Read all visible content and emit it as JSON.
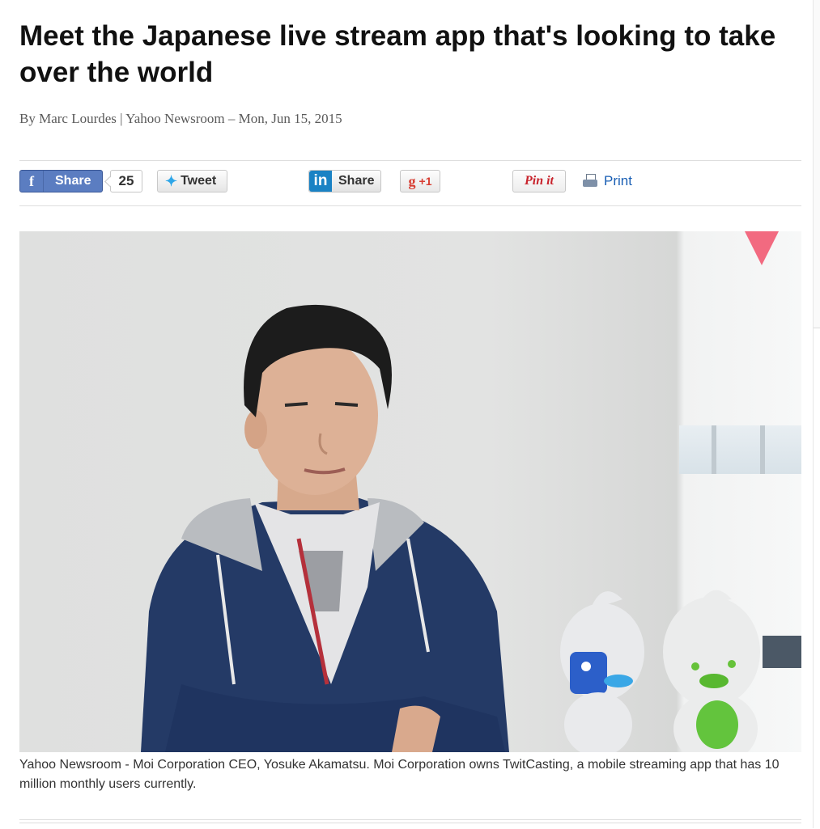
{
  "article": {
    "headline": "Meet the Japanese live stream app that's looking to take over the world",
    "byline": "By Marc Lourdes | Yahoo Newsroom – Mon, Jun 15, 2015",
    "caption": "Yahoo Newsroom - Moi Corporation CEO, Yosuke Akamatsu. Moi Corporation owns TwitCasting, a mobile streaming app that has 10 million monthly users currently."
  },
  "share_bar": {
    "facebook": {
      "icon": "facebook-icon",
      "glyph": "f",
      "label": "Share",
      "count": "25",
      "color": "#5b7dc1"
    },
    "twitter": {
      "icon": "twitter-bird-icon",
      "label": "Tweet",
      "color": "#2ea6e8"
    },
    "linkedin": {
      "icon": "linkedin-icon",
      "glyph": "in",
      "label": "Share",
      "color": "#1a82c4"
    },
    "google_plus": {
      "icon": "google-plus-icon",
      "glyph": "g",
      "label": "+1",
      "color": "#d73d32"
    },
    "pinterest": {
      "label": "Pin it",
      "color": "#c8232c"
    },
    "print": {
      "icon": "printer-icon",
      "label": "Print",
      "color": "#1a5fb4"
    }
  },
  "colors": {
    "accent_triangle": "#f26a80"
  }
}
